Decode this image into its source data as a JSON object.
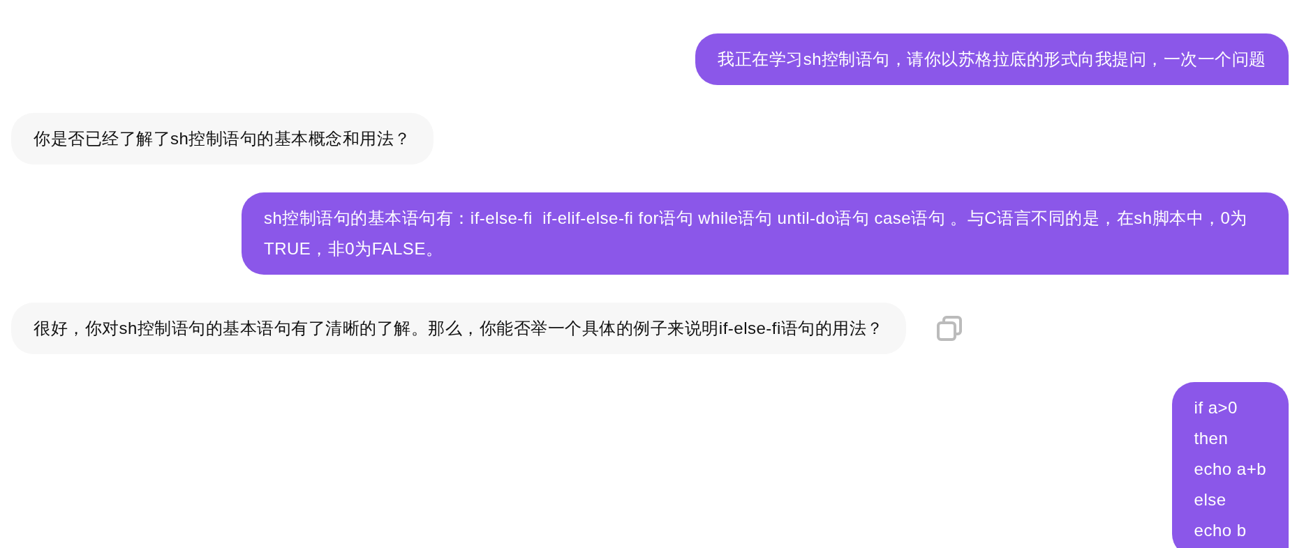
{
  "messages": [
    {
      "kind": "user",
      "text": "我正在学习sh控制语句，请你以苏格拉底的形式向我提问，一次一个问题",
      "copy_button": false
    },
    {
      "kind": "assistant",
      "text": "你是否已经了解了sh控制语句的基本概念和用法？",
      "copy_button": false
    },
    {
      "kind": "user",
      "text": "sh控制语句的基本语句有：if-else-fi  if-elif-else-fi for语句 while语句 until-do语句 case语句 。与C语言不同的是，在sh脚本中，0为TRUE，非0为FALSE。",
      "copy_button": false
    },
    {
      "kind": "assistant",
      "text": "很好，你对sh控制语句的基本语句有了清晰的了解。那么，你能否举一个具体的例子来说明if-else-fi语句的用法？",
      "copy_button": true
    },
    {
      "kind": "user",
      "text": "if a>0\nthen\necho a+b\nelse\necho b",
      "copy_button": false
    }
  ]
}
